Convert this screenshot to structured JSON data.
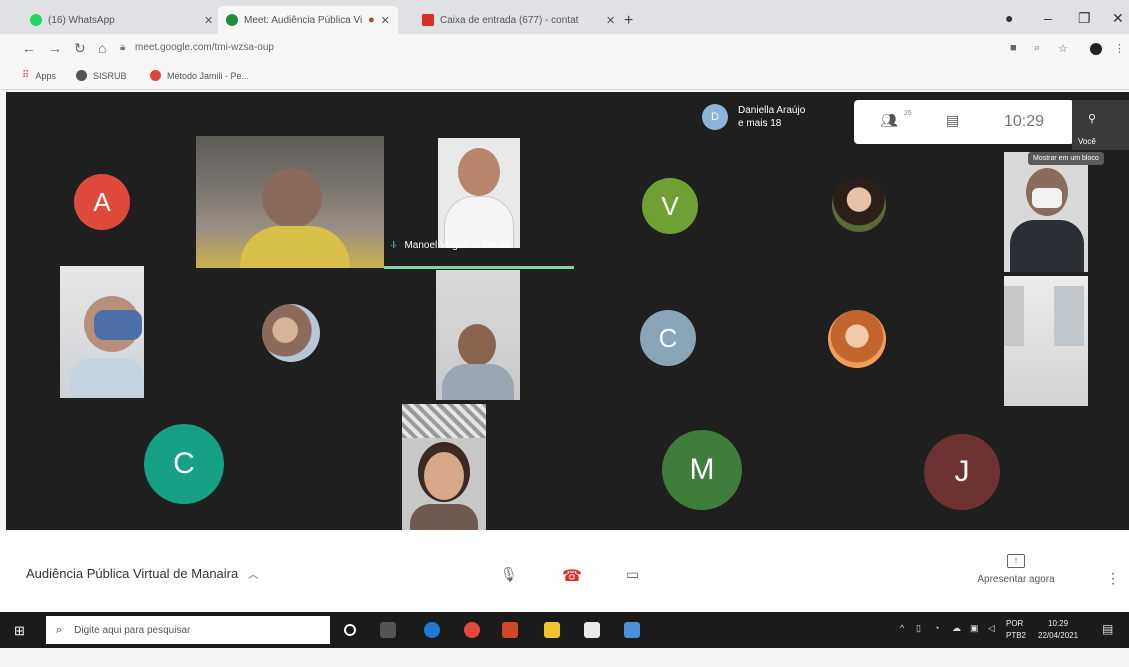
{
  "browser": {
    "tabs": [
      {
        "label": "(16) WhatsApp",
        "favicon_color": "#25d366"
      },
      {
        "label": "Meet: Audiência Pública Vi",
        "favicon_color": "#1e8e3e",
        "recording": true
      },
      {
        "label": "Caixa de entrada (677) - contat",
        "favicon_color": "#d93025"
      }
    ],
    "new_tab": "+",
    "url": "meet.google.com/tmi-wzsa-oup",
    "bookmarks": [
      {
        "label": "Apps",
        "color": "#ea4335"
      },
      {
        "label": "SISRUB",
        "color": "#555555"
      },
      {
        "label": "Método Jamili - Pe...",
        "color": "#e2453c"
      }
    ]
  },
  "meeting": {
    "speaker_name": "Manoel Virgulino Simão",
    "others": {
      "initial": "D",
      "name": "Daniella Araújo",
      "more": "e mais 18"
    },
    "participant_count": "26",
    "time": "10:29",
    "self_label": "Você",
    "tooltip": "Mostrar em um bloco",
    "avatars": [
      {
        "letter": "A",
        "color": "#e04a3c"
      },
      {
        "letter": "V",
        "color": "#6fa034"
      },
      {
        "letter": "C",
        "color": "#8aa4b8"
      },
      {
        "letter": "C",
        "color": "#16a085"
      },
      {
        "letter": "M",
        "color": "#3f7d3a"
      },
      {
        "letter": "J",
        "color": "#6d3333"
      }
    ],
    "title": "Audiência Pública Virtual de Manaira",
    "present_label": "Apresentar agora"
  },
  "taskbar": {
    "search_placeholder": "Digite aqui para pesquisar",
    "lang_top": "POR",
    "lang_bottom": "PTB2",
    "clock_time": "10:29",
    "clock_date": "22/04/2021"
  }
}
